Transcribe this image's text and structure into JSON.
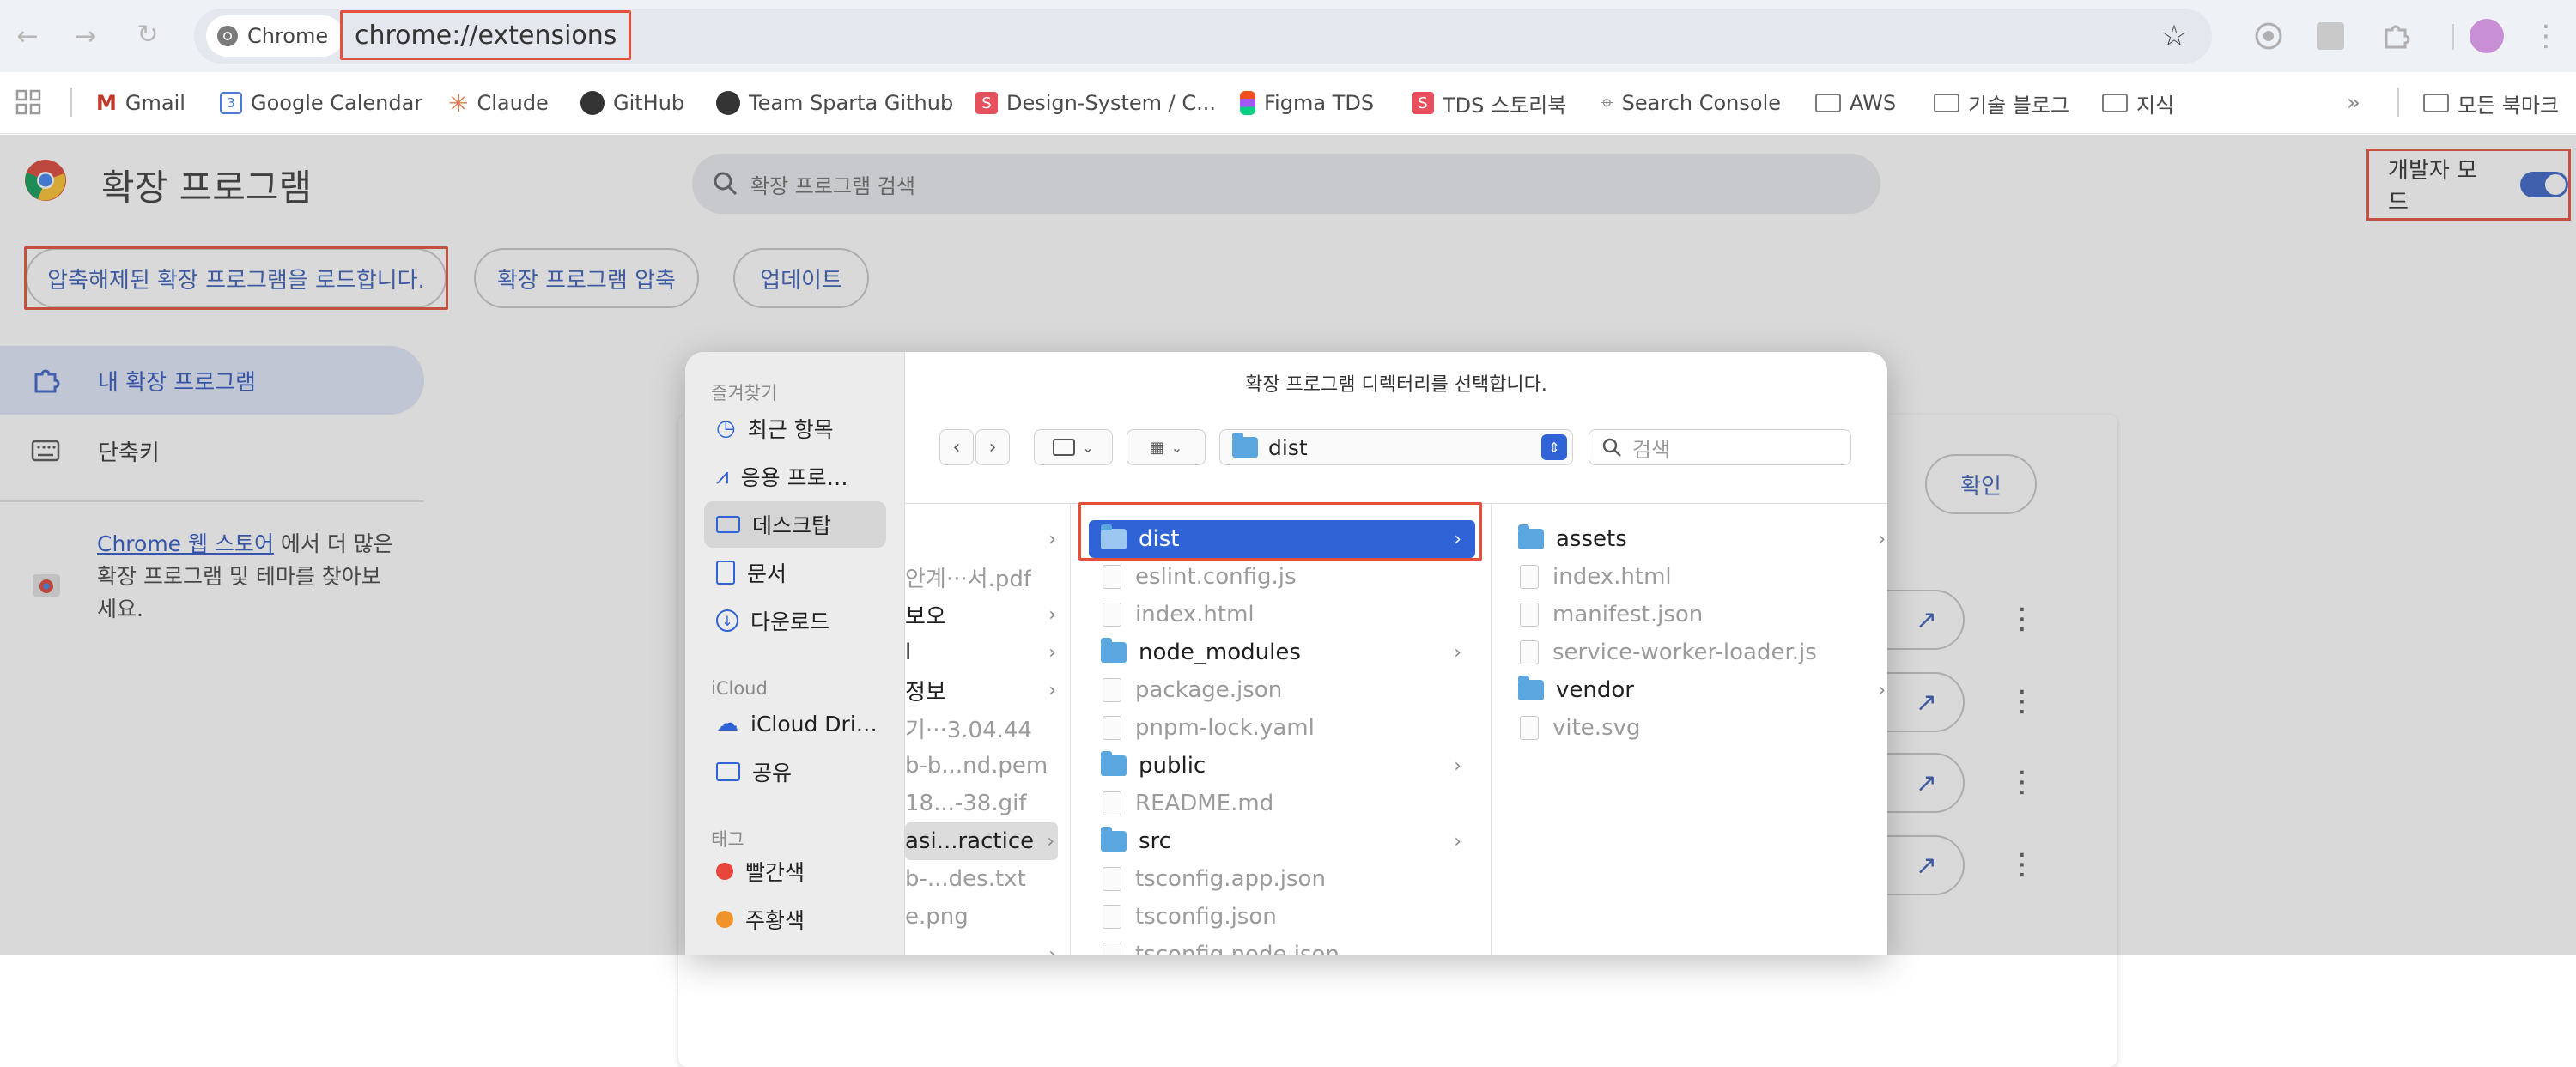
{
  "browser": {
    "chip_label": "Chrome",
    "url": "chrome://extensions",
    "bookmarks": [
      {
        "label": "Gmail",
        "icon": "gmail-icon"
      },
      {
        "label": "Google Calendar",
        "icon": "calendar-icon"
      },
      {
        "label": "Claude",
        "icon": "claude-icon"
      },
      {
        "label": "GitHub",
        "icon": "github-icon"
      },
      {
        "label": "Team Sparta Github",
        "icon": "github-icon"
      },
      {
        "label": "Design-System / C...",
        "icon": "sparta-icon"
      },
      {
        "label": "Figma TDS",
        "icon": "figma-icon"
      },
      {
        "label": "TDS 스토리북",
        "icon": "sparta-icon"
      },
      {
        "label": "Search Console",
        "icon": "search-console-icon"
      },
      {
        "label": "AWS",
        "icon": "folder-icon"
      },
      {
        "label": "기술 블로그",
        "icon": "folder-icon"
      },
      {
        "label": "지식",
        "icon": "folder-icon"
      }
    ],
    "bookmarks_all": "모든 북마크"
  },
  "extensions_page": {
    "title": "확장 프로그램",
    "search_placeholder": "확장 프로그램 검색",
    "dev_mode_label": "개발자 모드",
    "dev_mode_on": true,
    "buttons": {
      "load_unpacked": "압축해제된 확장 프로그램을 로드합니다.",
      "pack": "확장 프로그램 압축",
      "update": "업데이트"
    },
    "nav": {
      "my_extensions": "내 확장 프로그램",
      "shortcuts": "단축키"
    },
    "store_link": "Chrome 웹 스토어",
    "store_text_1": " 에서 더 많은",
    "store_text_2": "확장 프로그램 및 테마를 찾아보",
    "store_text_3": "세요.",
    "confirm_button": "확인"
  },
  "dialog": {
    "title": "확장 프로그램 디렉터리를 선택합니다.",
    "location": "dist",
    "search_placeholder": "검색",
    "sidebar": {
      "favorites_heading": "즐겨찾기",
      "favorites": [
        {
          "label": "최근 항목",
          "icon": "clock-icon"
        },
        {
          "label": "응용 프로…",
          "icon": "apps-icon"
        },
        {
          "label": "데스크탑",
          "icon": "desktop-icon",
          "selected": true
        },
        {
          "label": "문서",
          "icon": "document-icon"
        },
        {
          "label": "다운로드",
          "icon": "download-icon"
        }
      ],
      "icloud_heading": "iCloud",
      "icloud": [
        {
          "label": "iCloud Dri…",
          "icon": "cloud-icon"
        },
        {
          "label": "공유",
          "icon": "shared-folder-icon"
        }
      ],
      "tags_heading": "태그",
      "tags": [
        {
          "label": "빨간색",
          "color": "#e8453c"
        },
        {
          "label": "주황색",
          "color": "#f0932b"
        }
      ]
    },
    "col1": [
      {
        "name": "",
        "folder": true
      },
      {
        "name": "안계···서.pdf",
        "folder": false
      },
      {
        "name": "보오",
        "folder": true
      },
      {
        "name": "l",
        "folder": true
      },
      {
        "name": "정보",
        "folder": true
      },
      {
        "name": "기···3.04.44",
        "folder": false
      },
      {
        "name": "b-b...nd.pem",
        "folder": false
      },
      {
        "name": "18...-38.gif",
        "folder": false
      },
      {
        "name": "asi...ractice",
        "folder": true,
        "selected": true
      },
      {
        "name": "b-...des.txt",
        "folder": false
      },
      {
        "name": "e.png",
        "folder": false
      },
      {
        "name": "",
        "folder": true
      }
    ],
    "col2": [
      {
        "name": "dist",
        "folder": true,
        "selected": true
      },
      {
        "name": "eslint.config.js",
        "folder": false
      },
      {
        "name": "index.html",
        "folder": false
      },
      {
        "name": "node_modules",
        "folder": true
      },
      {
        "name": "package.json",
        "folder": false
      },
      {
        "name": "pnpm-lock.yaml",
        "folder": false
      },
      {
        "name": "public",
        "folder": true
      },
      {
        "name": "README.md",
        "folder": false
      },
      {
        "name": "src",
        "folder": true
      },
      {
        "name": "tsconfig.app.json",
        "folder": false
      },
      {
        "name": "tsconfig.json",
        "folder": false
      },
      {
        "name": "tsconfig.node.json",
        "folder": false
      }
    ],
    "col3": [
      {
        "name": "assets",
        "folder": true
      },
      {
        "name": "index.html",
        "folder": false
      },
      {
        "name": "manifest.json",
        "folder": false
      },
      {
        "name": "service-worker-loader.js",
        "folder": false
      },
      {
        "name": "vendor",
        "folder": true
      },
      {
        "name": "vite.svg",
        "folder": false
      }
    ]
  },
  "colors": {
    "accent": "#2f63d6",
    "highlight": "#e5503b",
    "toggle": "#3b64c8"
  }
}
